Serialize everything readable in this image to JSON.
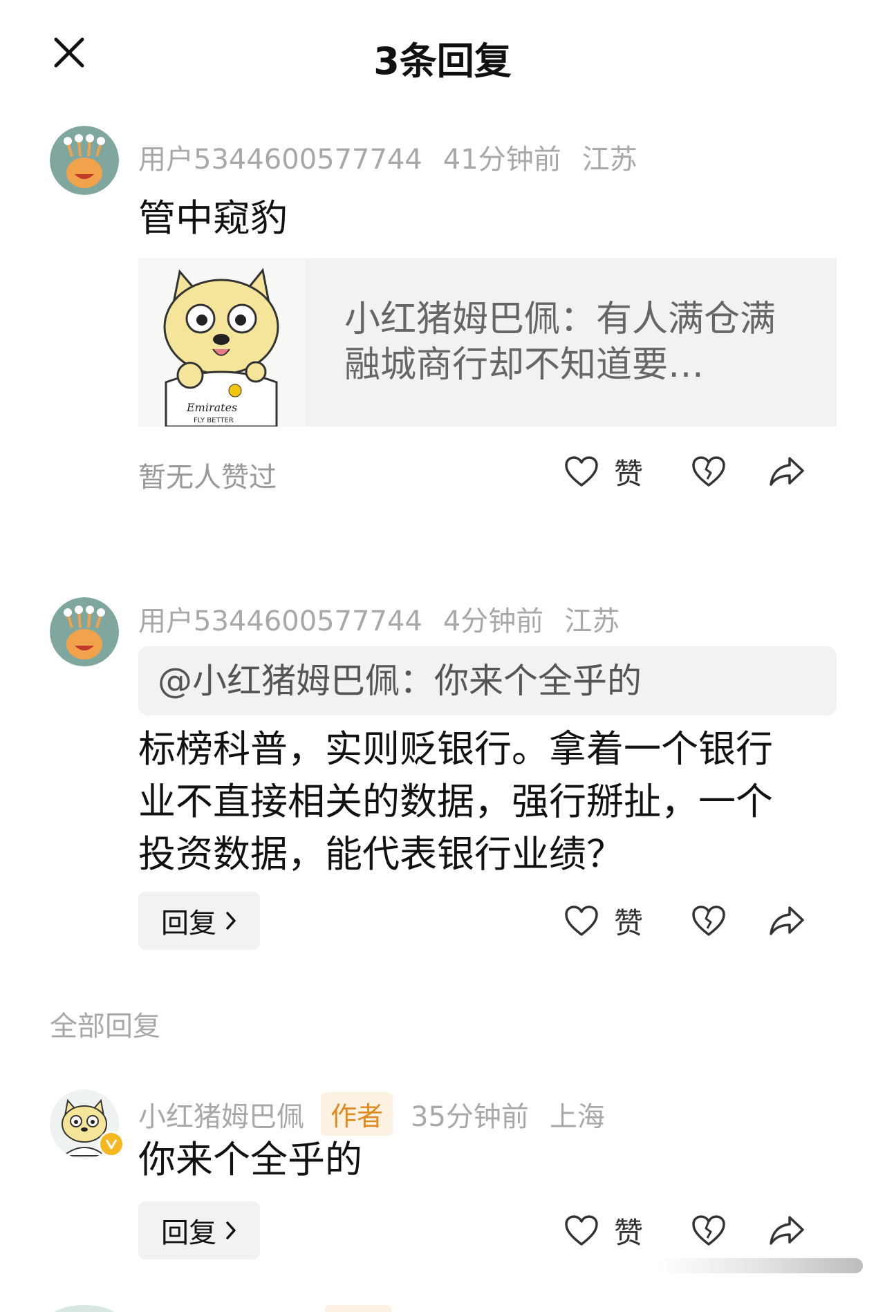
{
  "header": {
    "title": "3条回复",
    "close_icon": "close-icon"
  },
  "comments": [
    {
      "user": "用户5344600577744",
      "time": "41分钟前",
      "location": "江苏",
      "text": "管中窥豹",
      "card": {
        "text": "小红猪姆巴佩：有人满仓满融城商行却不知道要…"
      },
      "likes_text": "暂无人赞过",
      "like_label": "赞"
    },
    {
      "user": "用户5344600577744",
      "time": "4分钟前",
      "location": "江苏",
      "quote": "@小红猪姆巴佩：你来个全乎的",
      "text_lines": [
        "标榜科普，实则贬银行。拿着一个银行",
        "业不直接相关的数据，强行掰扯，一个",
        "投资数据，能代表银行业绩？"
      ],
      "reply_label": "回复",
      "like_label": "赞"
    }
  ],
  "section_label": "全部回复",
  "replies": [
    {
      "user": "小红猪姆巴佩",
      "author_tag": "作者",
      "time": "35分钟前",
      "location": "上海",
      "text": "你来个全乎的",
      "reply_label": "回复",
      "like_label": "赞"
    }
  ],
  "colors": {
    "meta": "#a8a8a8",
    "author_tag_bg": "#fdf2e2",
    "author_tag_text": "#e08a1e",
    "card_bg": "#f2f2f2"
  }
}
